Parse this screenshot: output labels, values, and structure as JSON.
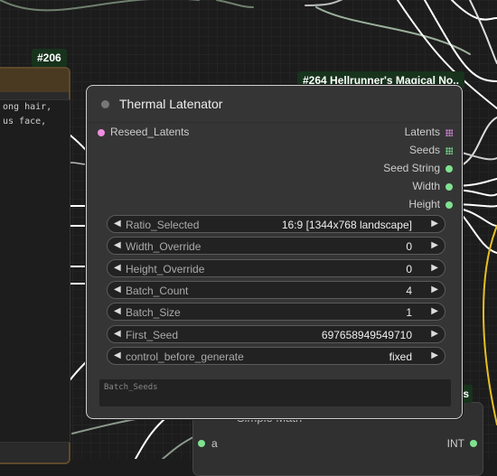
{
  "node206": {
    "badge": "#206",
    "text_lines": [
      "ong hair,",
      "us face,"
    ]
  },
  "main_node": {
    "badge": "#264 Hellrunner's Magical No..",
    "title": "Thermal Latenator",
    "input": "Reseed_Latents",
    "outputs": [
      {
        "label": "Latents",
        "icon": "grid-icon",
        "color": "#d98be0"
      },
      {
        "label": "Seeds",
        "icon": "grid-icon",
        "color": "#7ee28f"
      },
      {
        "label": "Seed String",
        "icon": "dot-icon",
        "color": "#7ee28f"
      },
      {
        "label": "Width",
        "icon": "dot-icon",
        "color": "#7ee28f"
      },
      {
        "label": "Height",
        "icon": "dot-icon",
        "color": "#7ee28f"
      }
    ],
    "widgets": [
      {
        "label": "Ratio_Selected",
        "value": "16:9 [1344x768 landscape]"
      },
      {
        "label": "Width_Override",
        "value": "0"
      },
      {
        "label": "Height_Override",
        "value": "0"
      },
      {
        "label": "Batch_Count",
        "value": "4"
      },
      {
        "label": "Batch_Size",
        "value": "1"
      },
      {
        "label": "First_Seed",
        "value": "697658949549710"
      },
      {
        "label": "control_before_generate",
        "value": "fixed"
      }
    ],
    "textarea_placeholder": "Batch_Seeds"
  },
  "math_node": {
    "title": "Simple Math",
    "badge_fragment": "ials",
    "input_a": "a",
    "output_int": "INT"
  },
  "colors": {
    "accent_green": "#7ee28f",
    "accent_pink": "#f08ee0",
    "wire_yellow": "#e8c020"
  }
}
